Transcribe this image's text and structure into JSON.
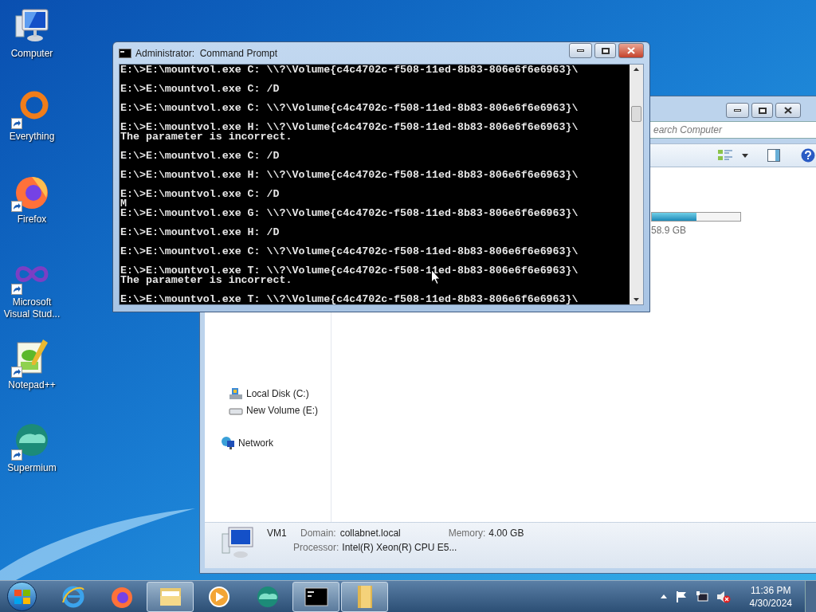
{
  "desktop_icons": [
    {
      "label": "Computer",
      "shortcut": false
    },
    {
      "label": "Everything",
      "shortcut": true
    },
    {
      "label": "Firefox",
      "shortcut": true
    },
    {
      "label": "Microsoft Visual Stud...",
      "shortcut": true
    },
    {
      "label": "Notepad++",
      "shortcut": true
    },
    {
      "label": "Supermium",
      "shortcut": true
    }
  ],
  "explorer_window": {
    "search": {
      "placeholder": "earch Computer"
    },
    "drive": {
      "level": 0.5,
      "size": "58.9 GB"
    },
    "nav": [
      {
        "label": "Local Disk (C:)",
        "kind": "disk"
      },
      {
        "label": "New Volume (E:)",
        "kind": "drive"
      },
      {
        "label": "Network",
        "kind": "network"
      }
    ],
    "details": {
      "name": "VM1",
      "domain_label": "Domain:",
      "domain": "collabnet.local",
      "memory_label": "Memory:",
      "memory": "4.00 GB",
      "processor_label": "Processor:",
      "processor": "Intel(R) Xeon(R) CPU E5..."
    }
  },
  "cmd_window": {
    "title": "Administrator:  Command Prompt",
    "blocks": [
      [
        "E:\\>E:\\mountvol.exe C: \\\\?\\Volume{c4c4702c-f508-11ed-8b83-806e6f6e6963}\\"
      ],
      [
        "E:\\>E:\\mountvol.exe C: /D"
      ],
      [
        "E:\\>E:\\mountvol.exe C: \\\\?\\Volume{c4c4702c-f508-11ed-8b83-806e6f6e6963}\\"
      ],
      [
        "E:\\>E:\\mountvol.exe H: \\\\?\\Volume{c4c4702c-f508-11ed-8b83-806e6f6e6963}\\",
        "The parameter is incorrect."
      ],
      [
        "E:\\>E:\\mountvol.exe C: /D"
      ],
      [
        "E:\\>E:\\mountvol.exe H: \\\\?\\Volume{c4c4702c-f508-11ed-8b83-806e6f6e6963}\\"
      ],
      [
        "E:\\>E:\\mountvol.exe C: /D",
        "M",
        "E:\\>E:\\mountvol.exe G: \\\\?\\Volume{c4c4702c-f508-11ed-8b83-806e6f6e6963}\\"
      ],
      [
        "E:\\>E:\\mountvol.exe H: /D"
      ],
      [
        "E:\\>E:\\mountvol.exe C: \\\\?\\Volume{c4c4702c-f508-11ed-8b83-806e6f6e6963}\\"
      ],
      [
        "E:\\>E:\\mountvol.exe T: \\\\?\\Volume{c4c4702c-f508-11ed-8b83-806e6f6e6963}\\",
        "The parameter is incorrect."
      ],
      [
        "E:\\>E:\\mountvol.exe T: \\\\?\\Volume{c4c4702c-f508-11ed-8b83-806e6f6e6963}\\"
      ]
    ]
  },
  "taskbar": {
    "items": [
      {
        "kind": "ie",
        "running": false
      },
      {
        "kind": "firefox",
        "running": false
      },
      {
        "kind": "explorer",
        "running": true
      },
      {
        "kind": "media",
        "running": false
      },
      {
        "kind": "supermium",
        "running": false
      },
      {
        "kind": "cmd",
        "running": true
      },
      {
        "kind": "folder",
        "running": true
      }
    ],
    "clock": {
      "time": "11:36 PM",
      "date": "4/30/2024"
    }
  }
}
